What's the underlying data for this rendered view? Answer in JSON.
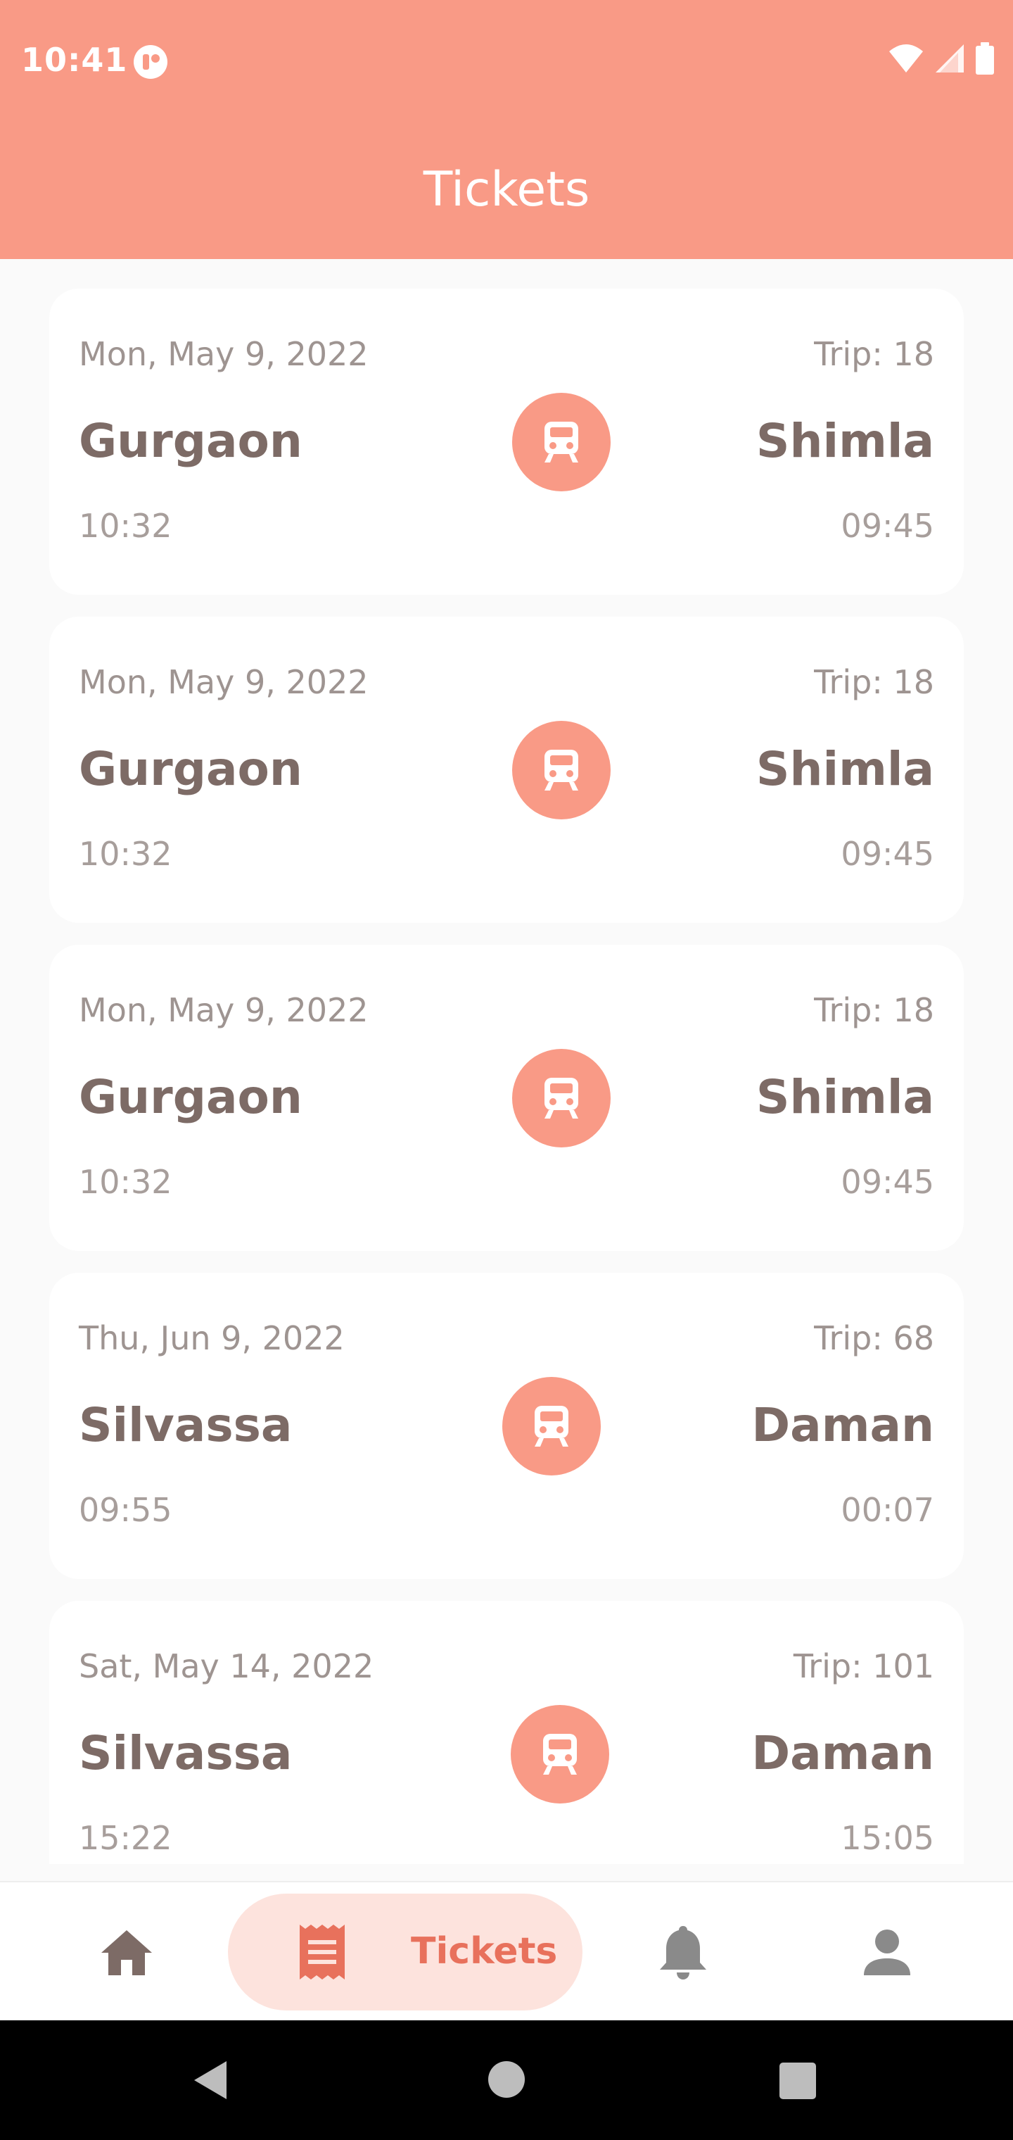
{
  "status_bar": {
    "time": "10:41"
  },
  "header": {
    "title": "Tickets"
  },
  "tickets": [
    {
      "date": "Mon, May 9, 2022",
      "trip": "Trip: 18",
      "from": "Gurgaon",
      "to": "Shimla",
      "departure": "10:32",
      "arrival": "09:45"
    },
    {
      "date": "Mon, May 9, 2022",
      "trip": "Trip: 18",
      "from": "Gurgaon",
      "to": "Shimla",
      "departure": "10:32",
      "arrival": "09:45"
    },
    {
      "date": "Mon, May 9, 2022",
      "trip": "Trip: 18",
      "from": "Gurgaon",
      "to": "Shimla",
      "departure": "10:32",
      "arrival": "09:45"
    },
    {
      "date": "Thu, Jun 9, 2022",
      "trip": "Trip: 68",
      "from": "Silvassa",
      "to": "Daman",
      "departure": "09:55",
      "arrival": "00:07"
    },
    {
      "date": "Sat, May 14, 2022",
      "trip": "Trip: 101",
      "from": "Silvassa",
      "to": "Daman",
      "departure": "15:22",
      "arrival": "15:05"
    }
  ],
  "bottom_nav": {
    "items": [
      {
        "icon": "home-icon",
        "label": ""
      },
      {
        "icon": "ticket-icon",
        "label": "Tickets",
        "active": true
      },
      {
        "icon": "bell-icon",
        "label": ""
      },
      {
        "icon": "person-icon",
        "label": ""
      }
    ]
  },
  "colors": {
    "accent": "#F99A86",
    "active_pill": "#FDE3DD",
    "active_label": "#E8715C",
    "text_primary": "#7D6B66"
  },
  "icons": {
    "ticket_badge": "train-icon"
  }
}
